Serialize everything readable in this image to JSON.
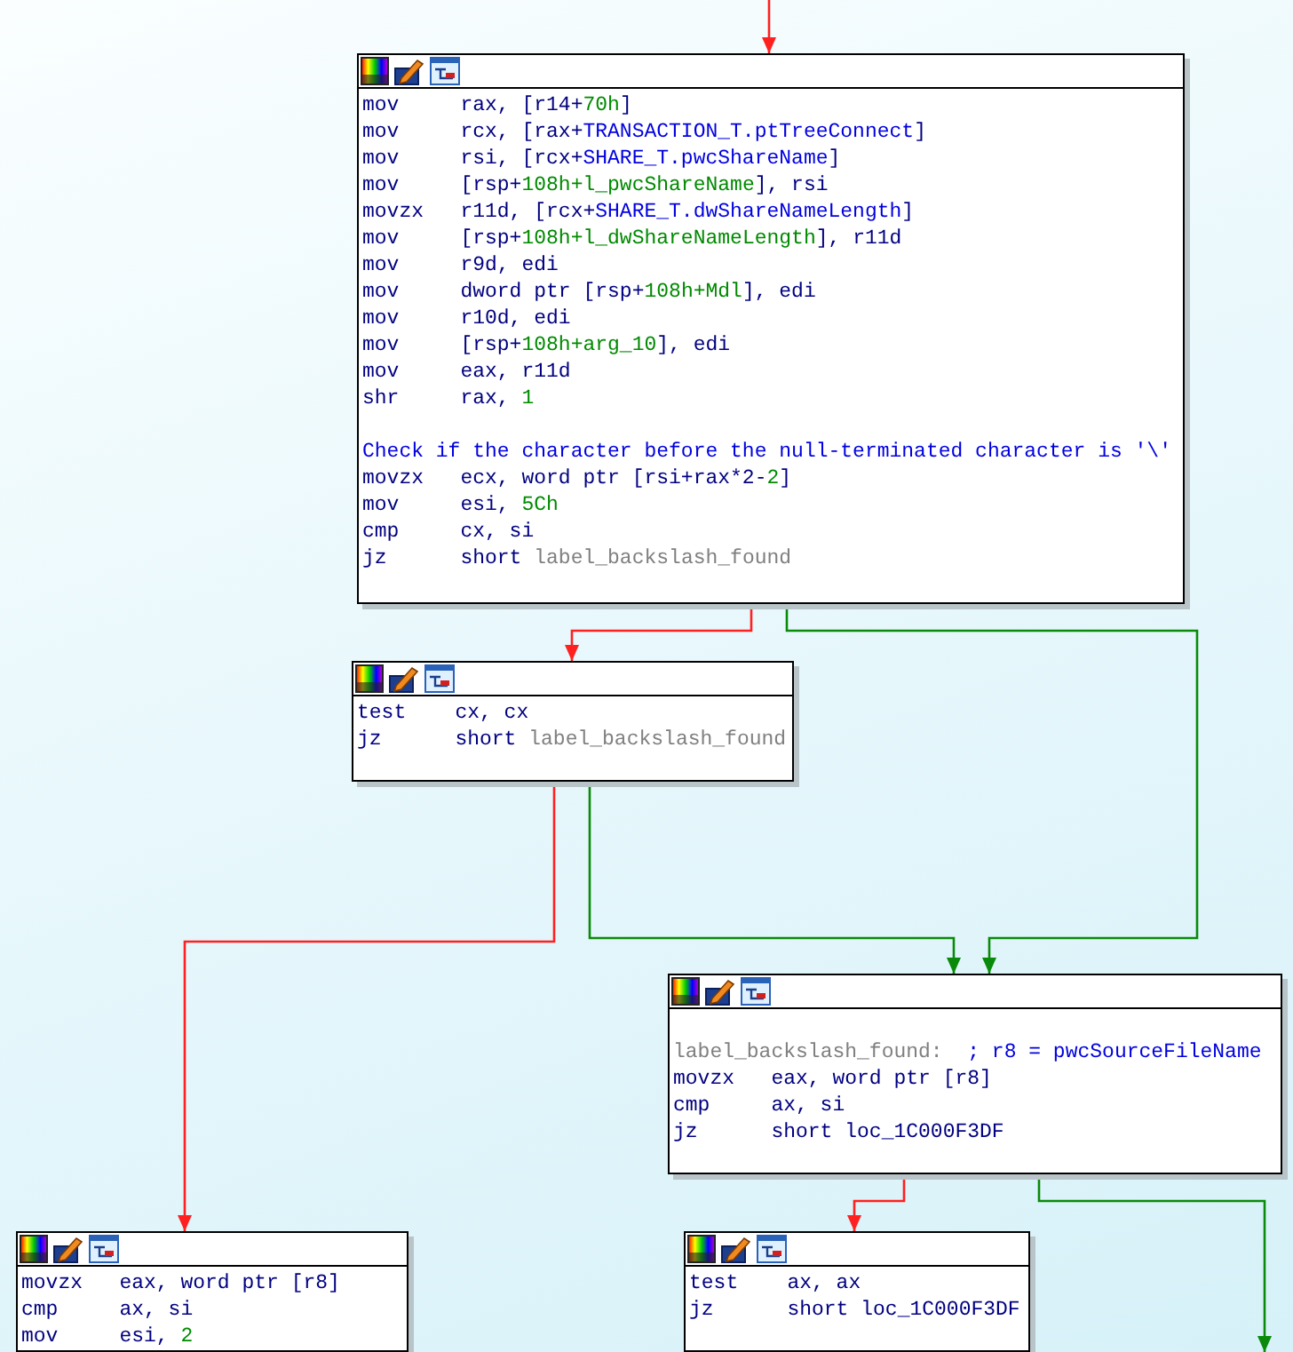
{
  "edges": [
    {
      "kind": "not_taken"
    },
    {
      "kind": "not_taken"
    },
    {
      "kind": "taken"
    },
    {
      "kind": "taken"
    },
    {
      "kind": "not_taken"
    },
    {
      "kind": "not_taken"
    },
    {
      "kind": "taken"
    }
  ],
  "nodes": [
    {
      "lines": [
        {
          "kind": "instruction",
          "mnemonic": "mov",
          "operands": [
            {
              "kind": "reg",
              "text": "rax, [r14+"
            },
            {
              "kind": "num",
              "text": "70h"
            },
            {
              "kind": "reg",
              "text": "]"
            }
          ]
        },
        {
          "kind": "instruction",
          "mnemonic": "mov",
          "operands": [
            {
              "kind": "reg",
              "text": "rcx, [rax+"
            },
            {
              "kind": "name",
              "text": "TRANSACTION_T.ptTreeConnect"
            },
            {
              "kind": "reg",
              "text": "]"
            }
          ]
        },
        {
          "kind": "instruction",
          "mnemonic": "mov",
          "operands": [
            {
              "kind": "reg",
              "text": "rsi, [rcx+"
            },
            {
              "kind": "name",
              "text": "SHARE_T.pwcShareName"
            },
            {
              "kind": "reg",
              "text": "]"
            }
          ]
        },
        {
          "kind": "instruction",
          "mnemonic": "mov",
          "operands": [
            {
              "kind": "reg",
              "text": "[rsp+"
            },
            {
              "kind": "num",
              "text": "108h+l_pwcShareName"
            },
            {
              "kind": "reg",
              "text": "], rsi"
            }
          ]
        },
        {
          "kind": "instruction",
          "mnemonic": "movzx",
          "operands": [
            {
              "kind": "reg",
              "text": "r11d, [rcx+"
            },
            {
              "kind": "name",
              "text": "SHARE_T.dwShareNameLength"
            },
            {
              "kind": "reg",
              "text": "]"
            }
          ]
        },
        {
          "kind": "instruction",
          "mnemonic": "mov",
          "operands": [
            {
              "kind": "reg",
              "text": "[rsp+"
            },
            {
              "kind": "num",
              "text": "108h+l_dwShareNameLength"
            },
            {
              "kind": "reg",
              "text": "], r11d"
            }
          ]
        },
        {
          "kind": "instruction",
          "mnemonic": "mov",
          "operands": [
            {
              "kind": "reg",
              "text": "r9d, edi"
            }
          ]
        },
        {
          "kind": "instruction",
          "mnemonic": "mov",
          "operands": [
            {
              "kind": "reg",
              "text": "dword ptr [rsp+"
            },
            {
              "kind": "num",
              "text": "108h+Mdl"
            },
            {
              "kind": "reg",
              "text": "], edi"
            }
          ]
        },
        {
          "kind": "instruction",
          "mnemonic": "mov",
          "operands": [
            {
              "kind": "reg",
              "text": "r10d, edi"
            }
          ]
        },
        {
          "kind": "instruction",
          "mnemonic": "mov",
          "operands": [
            {
              "kind": "reg",
              "text": "[rsp+"
            },
            {
              "kind": "num",
              "text": "108h+arg_10"
            },
            {
              "kind": "reg",
              "text": "], edi"
            }
          ]
        },
        {
          "kind": "instruction",
          "mnemonic": "mov",
          "operands": [
            {
              "kind": "reg",
              "text": "eax, r11d"
            }
          ]
        },
        {
          "kind": "instruction",
          "mnemonic": "shr",
          "operands": [
            {
              "kind": "reg",
              "text": "rax, "
            },
            {
              "kind": "num",
              "text": "1"
            }
          ]
        },
        {
          "kind": "comment",
          "text": "Check if the character before the null-terminated character is '\\'"
        },
        {
          "kind": "instruction",
          "mnemonic": "movzx",
          "operands": [
            {
              "kind": "reg",
              "text": "ecx, word ptr [rsi+rax*2-"
            },
            {
              "kind": "num",
              "text": "2"
            },
            {
              "kind": "reg",
              "text": "]"
            }
          ]
        },
        {
          "kind": "instruction",
          "mnemonic": "mov",
          "operands": [
            {
              "kind": "reg",
              "text": "esi, "
            },
            {
              "kind": "num",
              "text": "5Ch"
            }
          ]
        },
        {
          "kind": "instruction",
          "mnemonic": "cmp",
          "operands": [
            {
              "kind": "reg",
              "text": "cx, si"
            }
          ]
        },
        {
          "kind": "instruction",
          "mnemonic": "jz",
          "operands": [
            {
              "kind": "reg",
              "text": "short "
            },
            {
              "kind": "label",
              "text": "label_backslash_found"
            }
          ]
        }
      ]
    },
    {
      "lines": [
        {
          "kind": "instruction",
          "mnemonic": "test",
          "operands": [
            {
              "kind": "reg",
              "text": "cx, cx"
            }
          ]
        },
        {
          "kind": "instruction",
          "mnemonic": "jz",
          "operands": [
            {
              "kind": "reg",
              "text": "short "
            },
            {
              "kind": "label",
              "text": "label_backslash_found"
            }
          ]
        }
      ]
    },
    {
      "lines": [
        {
          "kind": "label",
          "text": "label_backslash_found:",
          "comment": "; r8 = pwcSourceFileName"
        },
        {
          "kind": "instruction",
          "mnemonic": "movzx",
          "operands": [
            {
              "kind": "reg",
              "text": "eax, word ptr [r8]"
            }
          ]
        },
        {
          "kind": "instruction",
          "mnemonic": "cmp",
          "operands": [
            {
              "kind": "reg",
              "text": "ax, si"
            }
          ]
        },
        {
          "kind": "instruction",
          "mnemonic": "jz",
          "operands": [
            {
              "kind": "reg",
              "text": "short loc_1C000F3DF"
            }
          ]
        }
      ]
    },
    {
      "lines": [
        {
          "kind": "instruction",
          "mnemonic": "movzx",
          "operands": [
            {
              "kind": "reg",
              "text": "eax, word ptr [r8]"
            }
          ]
        },
        {
          "kind": "instruction",
          "mnemonic": "cmp",
          "operands": [
            {
              "kind": "reg",
              "text": "ax, si"
            }
          ]
        },
        {
          "kind": "instruction",
          "mnemonic": "mov",
          "operands": [
            {
              "kind": "reg",
              "text": "esi, "
            },
            {
              "kind": "num",
              "text": "2"
            }
          ]
        }
      ]
    },
    {
      "lines": [
        {
          "kind": "instruction",
          "mnemonic": "test",
          "operands": [
            {
              "kind": "reg",
              "text": "ax, ax"
            }
          ]
        },
        {
          "kind": "instruction",
          "mnemonic": "jz",
          "operands": [
            {
              "kind": "reg",
              "text": "short loc_1C000F3DF"
            }
          ]
        }
      ]
    }
  ]
}
